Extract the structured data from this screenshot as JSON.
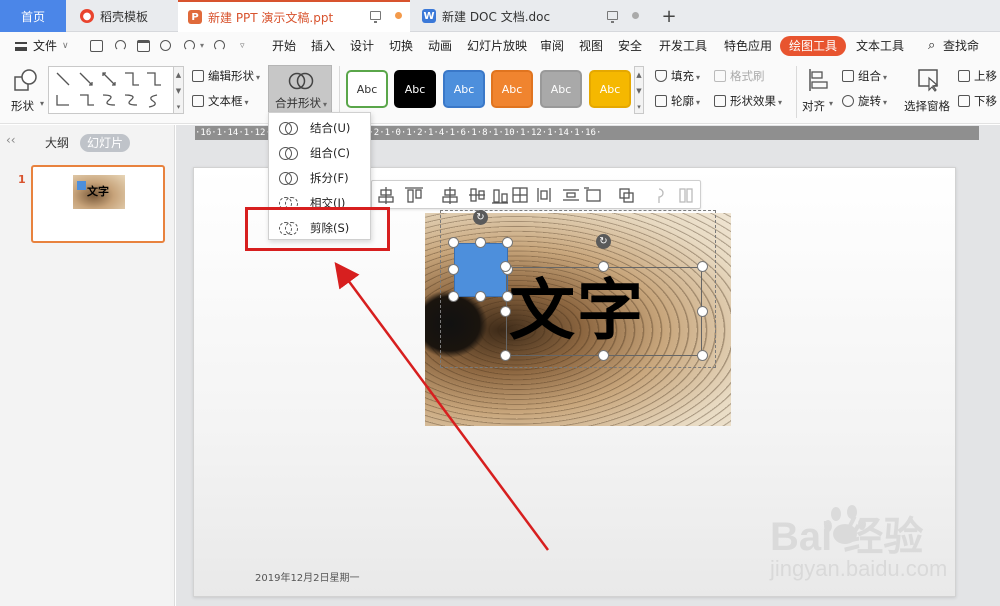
{
  "tabs": {
    "home": "首页",
    "daoke": "稻壳模板",
    "ppt": "新建 PPT 演示文稿.ppt",
    "doc": "新建 DOC 文档.doc",
    "add": "+"
  },
  "menu": {
    "file": "文件",
    "items": [
      "开始",
      "插入",
      "设计",
      "切换",
      "动画",
      "幻灯片放映",
      "审阅",
      "视图",
      "安全",
      "开发工具",
      "特色应用",
      "绘图工具",
      "文本工具"
    ],
    "search": "查找命令..."
  },
  "ribbon": {
    "shape": "形状",
    "edit_shape": "编辑形状",
    "text_box": "文本框",
    "merge_shape": "合并形状",
    "style_label": "Abc",
    "fill": "填充",
    "format_brush": "格式刷",
    "outline": "轮廓",
    "shape_effect": "形状效果",
    "align": "对齐",
    "group": "组合",
    "rotate": "旋转",
    "select_pane": "选择窗格",
    "move_up": "上移",
    "move_down": "下移"
  },
  "styles": [
    {
      "bg": "#ffffff",
      "fg": "#333333",
      "border": "#5aa64a"
    },
    {
      "bg": "#000000",
      "fg": "#ffffff",
      "border": "#000000"
    },
    {
      "bg": "#4d8fdc",
      "fg": "#ffffff",
      "border": "#3a78c8"
    },
    {
      "bg": "#f0842f",
      "fg": "#ffffff",
      "border": "#e0741f"
    },
    {
      "bg": "#a9a9a9",
      "fg": "#ffffff",
      "border": "#999999"
    },
    {
      "bg": "#f5b800",
      "fg": "#ffffff",
      "border": "#e5a800"
    }
  ],
  "merge_menu": {
    "items": [
      "结合(U)",
      "组合(C)",
      "拆分(F)",
      "相交(I)",
      "剪除(S)"
    ]
  },
  "left_panel": {
    "outline": "大纲",
    "slides": "幻灯片",
    "slide_number": "1",
    "thumb_text": "文字"
  },
  "ruler_text": "·16·1·14·1·12·1·10·1·8·1·6·1·4·1·2·1·0·1·2·1·4·1·6·1·8·1·10·1·12·1·14·1·16·",
  "slide": {
    "big_text": "文字",
    "date": "2019年12月2日星期一"
  },
  "watermark": {
    "logo": "Bai  经验",
    "url": "jingyan.baidu.com"
  },
  "colors": {
    "accent": "#e8542f",
    "highlight_red": "#d71f1f",
    "selection_blue": "#4d8fdc"
  }
}
